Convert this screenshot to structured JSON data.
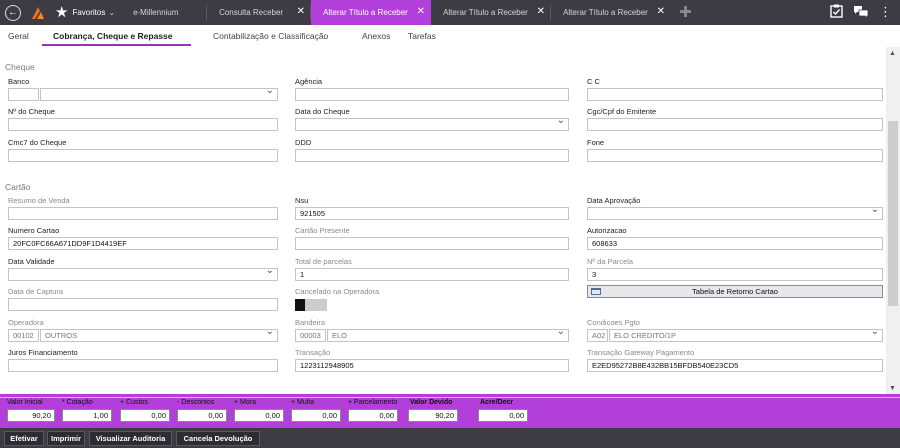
{
  "topbar": {
    "favorites_label": "Favoritos",
    "tabs": [
      {
        "label": "e-Millennium"
      },
      {
        "label": "Consulta Receber"
      },
      {
        "label": "Alterar Título a Receber"
      },
      {
        "label": "Alterar Título a Receber"
      },
      {
        "label": "Alterar Título a Receber"
      }
    ],
    "accent_color": "#b23fd9"
  },
  "subtabs": [
    "Geral",
    "Cobrança, Cheque e Repasse",
    "Contabilização e Classificação",
    "Anexos",
    "Tarefas"
  ],
  "cheque": {
    "section_title": "Cheque",
    "banco_label": "Banco",
    "agencia_label": "Agência",
    "cc_label": "C C",
    "num_cheque_label": "Nº do Cheque",
    "data_cheque_label": "Data do Cheque",
    "cgc_label": "Cgc/Cpf do Emitente",
    "cmc7_label": "Cmc7 do Cheque",
    "ddd_label": "DDD",
    "fone_label": "Fone"
  },
  "cartao": {
    "section_title": "Cartão",
    "resumo_label": "Resumo de Venda",
    "nsu_label": "Nsu",
    "nsu_value": "921505",
    "data_aprov_label": "Data Aprovação",
    "numero_cartao_label": "Numero Cartao",
    "numero_cartao_value": "20FC0FC66A671DD9F1D4419EF",
    "cartao_presente_label": "Cartão Presente",
    "autorizacao_label": "Autorizacao",
    "autorizacao_value": "608633",
    "data_validade_label": "Data Validade",
    "total_parcelas_label": "Total de parcelas",
    "total_parcelas_value": "1",
    "num_parcela_label": "Nº da Parcela",
    "num_parcela_value": "3",
    "data_captura_label": "Data de Captura",
    "cancelado_label": "Cancelado na Operadora",
    "tabela_retorno_label": "Tabela de Retorno Cartao",
    "operadora_label": "Operadora",
    "operadora_code": "00102",
    "operadora_name": "OUTROS",
    "bandeira_label": "Bandeira",
    "bandeira_code": "00003",
    "bandeira_name": "ELO",
    "condicoes_label": "Condicoes Pgto",
    "condicoes_code": "A02",
    "condicoes_name": "ELO CREDITO/1P",
    "juros_label": "Juros Financiamento",
    "transacao_label": "Transação",
    "transacao_value": "1223112948905",
    "gateway_label": "Transação Gateway Pagamento",
    "gateway_value": "E2ED95272B8E432BB15BFDB540E23CD5"
  },
  "totals": [
    {
      "label": "Valor Inicial",
      "value": "90,20"
    },
    {
      "label": "* Cotação",
      "value": "1,00"
    },
    {
      "label": "+ Custos",
      "value": "0,00"
    },
    {
      "label": "- Descontos",
      "value": "0,00"
    },
    {
      "label": "+ Mora",
      "value": "0,00"
    },
    {
      "label": "+ Multa",
      "value": "0,00"
    },
    {
      "label": "+ Parcelamento",
      "value": "0,00"
    },
    {
      "label": "Valor Devido",
      "value": "90,20"
    },
    {
      "label": "Acre/Decr",
      "value": "0,00"
    }
  ],
  "actions": [
    "Efetivar",
    "Imprimir",
    "Visualizar Auditoria",
    "Cancela Devolução"
  ]
}
